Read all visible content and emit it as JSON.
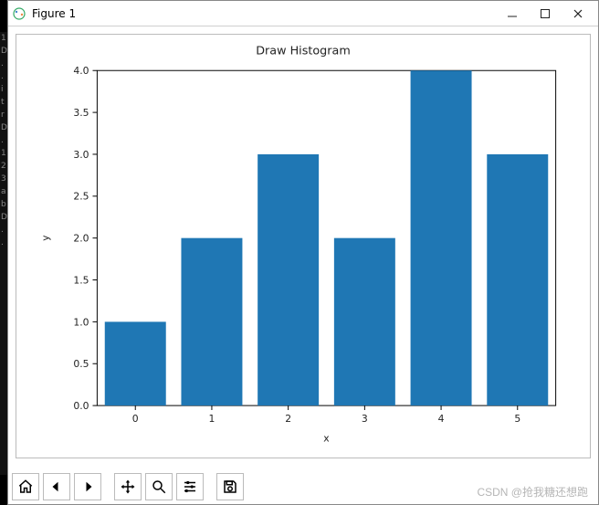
{
  "window": {
    "title": "Figure 1"
  },
  "chart_data": {
    "type": "bar",
    "title": "Draw Histogram",
    "xlabel": "x",
    "ylabel": "y",
    "categories": [
      0,
      1,
      2,
      3,
      4,
      5
    ],
    "values": [
      1,
      2,
      3,
      2,
      4,
      3
    ],
    "ylim": [
      0.0,
      4.0
    ],
    "yticks": [
      0.0,
      0.5,
      1.0,
      1.5,
      2.0,
      2.5,
      3.0,
      3.5,
      4.0
    ],
    "color": "#1f77b4"
  },
  "toolbar": {
    "home": "Home",
    "back": "Back",
    "forward": "Forward",
    "pan": "Pan",
    "zoom": "Zoom",
    "configure": "Configure subplots",
    "save": "Save"
  },
  "watermark": "CSDN @抢我糖还想跑"
}
